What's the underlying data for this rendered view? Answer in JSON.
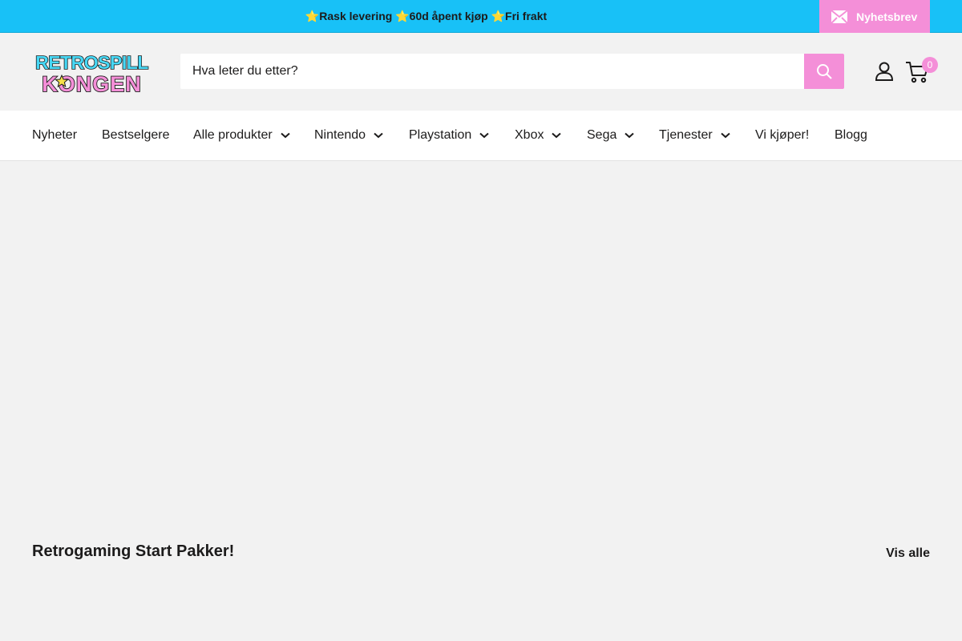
{
  "announcement": {
    "part1": "Rask levering ",
    "part2": "60d åpent kjøp ",
    "part3": "Fri frakt",
    "star": "⭐",
    "newsletter_label": "Nyhetsbrev"
  },
  "brand": {
    "logo_line1": "RETROSPILL",
    "logo_line2": "KONGEN",
    "colors": {
      "accent_blue": "#18c1f7",
      "accent_pink": "#f48fd8",
      "text": "#1c1b1b"
    }
  },
  "search": {
    "placeholder": "Hva leter du etter?",
    "icon": "search-icon"
  },
  "header_icons": {
    "account": "user-icon",
    "cart": "cart-icon",
    "cart_count": "0"
  },
  "nav": {
    "items": [
      {
        "label": "Nyheter",
        "dropdown": false
      },
      {
        "label": "Bestselgere",
        "dropdown": false
      },
      {
        "label": "Alle produkter",
        "dropdown": true
      },
      {
        "label": "Nintendo",
        "dropdown": true
      },
      {
        "label": "Playstation",
        "dropdown": true
      },
      {
        "label": "Xbox",
        "dropdown": true
      },
      {
        "label": "Sega",
        "dropdown": true
      },
      {
        "label": "Tjenester",
        "dropdown": true
      },
      {
        "label": "Vi kjøper!",
        "dropdown": false
      },
      {
        "label": "Blogg",
        "dropdown": false
      }
    ]
  },
  "collection": {
    "title": "Retrogaming Start Pakker!",
    "view_all": "Vis alle"
  }
}
